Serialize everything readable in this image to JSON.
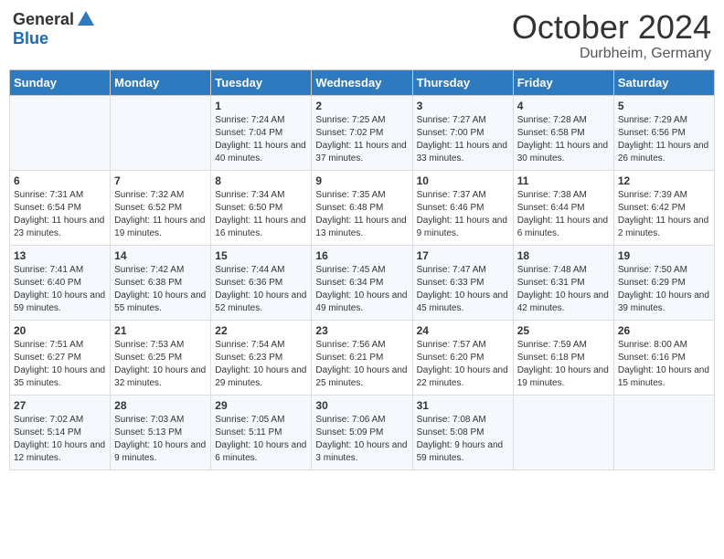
{
  "header": {
    "logo_general": "General",
    "logo_blue": "Blue",
    "month": "October 2024",
    "location": "Durbheim, Germany"
  },
  "days_of_week": [
    "Sunday",
    "Monday",
    "Tuesday",
    "Wednesday",
    "Thursday",
    "Friday",
    "Saturday"
  ],
  "weeks": [
    [
      {
        "day": "",
        "info": ""
      },
      {
        "day": "",
        "info": ""
      },
      {
        "day": "1",
        "info": "Sunrise: 7:24 AM\nSunset: 7:04 PM\nDaylight: 11 hours and 40 minutes."
      },
      {
        "day": "2",
        "info": "Sunrise: 7:25 AM\nSunset: 7:02 PM\nDaylight: 11 hours and 37 minutes."
      },
      {
        "day": "3",
        "info": "Sunrise: 7:27 AM\nSunset: 7:00 PM\nDaylight: 11 hours and 33 minutes."
      },
      {
        "day": "4",
        "info": "Sunrise: 7:28 AM\nSunset: 6:58 PM\nDaylight: 11 hours and 30 minutes."
      },
      {
        "day": "5",
        "info": "Sunrise: 7:29 AM\nSunset: 6:56 PM\nDaylight: 11 hours and 26 minutes."
      }
    ],
    [
      {
        "day": "6",
        "info": "Sunrise: 7:31 AM\nSunset: 6:54 PM\nDaylight: 11 hours and 23 minutes."
      },
      {
        "day": "7",
        "info": "Sunrise: 7:32 AM\nSunset: 6:52 PM\nDaylight: 11 hours and 19 minutes."
      },
      {
        "day": "8",
        "info": "Sunrise: 7:34 AM\nSunset: 6:50 PM\nDaylight: 11 hours and 16 minutes."
      },
      {
        "day": "9",
        "info": "Sunrise: 7:35 AM\nSunset: 6:48 PM\nDaylight: 11 hours and 13 minutes."
      },
      {
        "day": "10",
        "info": "Sunrise: 7:37 AM\nSunset: 6:46 PM\nDaylight: 11 hours and 9 minutes."
      },
      {
        "day": "11",
        "info": "Sunrise: 7:38 AM\nSunset: 6:44 PM\nDaylight: 11 hours and 6 minutes."
      },
      {
        "day": "12",
        "info": "Sunrise: 7:39 AM\nSunset: 6:42 PM\nDaylight: 11 hours and 2 minutes."
      }
    ],
    [
      {
        "day": "13",
        "info": "Sunrise: 7:41 AM\nSunset: 6:40 PM\nDaylight: 10 hours and 59 minutes."
      },
      {
        "day": "14",
        "info": "Sunrise: 7:42 AM\nSunset: 6:38 PM\nDaylight: 10 hours and 55 minutes."
      },
      {
        "day": "15",
        "info": "Sunrise: 7:44 AM\nSunset: 6:36 PM\nDaylight: 10 hours and 52 minutes."
      },
      {
        "day": "16",
        "info": "Sunrise: 7:45 AM\nSunset: 6:34 PM\nDaylight: 10 hours and 49 minutes."
      },
      {
        "day": "17",
        "info": "Sunrise: 7:47 AM\nSunset: 6:33 PM\nDaylight: 10 hours and 45 minutes."
      },
      {
        "day": "18",
        "info": "Sunrise: 7:48 AM\nSunset: 6:31 PM\nDaylight: 10 hours and 42 minutes."
      },
      {
        "day": "19",
        "info": "Sunrise: 7:50 AM\nSunset: 6:29 PM\nDaylight: 10 hours and 39 minutes."
      }
    ],
    [
      {
        "day": "20",
        "info": "Sunrise: 7:51 AM\nSunset: 6:27 PM\nDaylight: 10 hours and 35 minutes."
      },
      {
        "day": "21",
        "info": "Sunrise: 7:53 AM\nSunset: 6:25 PM\nDaylight: 10 hours and 32 minutes."
      },
      {
        "day": "22",
        "info": "Sunrise: 7:54 AM\nSunset: 6:23 PM\nDaylight: 10 hours and 29 minutes."
      },
      {
        "day": "23",
        "info": "Sunrise: 7:56 AM\nSunset: 6:21 PM\nDaylight: 10 hours and 25 minutes."
      },
      {
        "day": "24",
        "info": "Sunrise: 7:57 AM\nSunset: 6:20 PM\nDaylight: 10 hours and 22 minutes."
      },
      {
        "day": "25",
        "info": "Sunrise: 7:59 AM\nSunset: 6:18 PM\nDaylight: 10 hours and 19 minutes."
      },
      {
        "day": "26",
        "info": "Sunrise: 8:00 AM\nSunset: 6:16 PM\nDaylight: 10 hours and 15 minutes."
      }
    ],
    [
      {
        "day": "27",
        "info": "Sunrise: 7:02 AM\nSunset: 5:14 PM\nDaylight: 10 hours and 12 minutes."
      },
      {
        "day": "28",
        "info": "Sunrise: 7:03 AM\nSunset: 5:13 PM\nDaylight: 10 hours and 9 minutes."
      },
      {
        "day": "29",
        "info": "Sunrise: 7:05 AM\nSunset: 5:11 PM\nDaylight: 10 hours and 6 minutes."
      },
      {
        "day": "30",
        "info": "Sunrise: 7:06 AM\nSunset: 5:09 PM\nDaylight: 10 hours and 3 minutes."
      },
      {
        "day": "31",
        "info": "Sunrise: 7:08 AM\nSunset: 5:08 PM\nDaylight: 9 hours and 59 minutes."
      },
      {
        "day": "",
        "info": ""
      },
      {
        "day": "",
        "info": ""
      }
    ]
  ]
}
